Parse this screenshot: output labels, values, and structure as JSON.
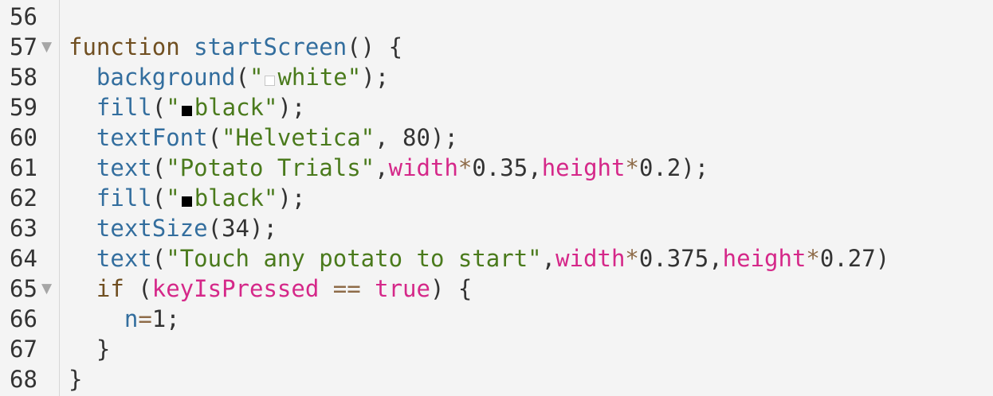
{
  "colors": {
    "background": "#f4f4f4",
    "gutter_border": "#d6d6d6",
    "keyword": "#704f21",
    "function": "#336e9e",
    "string": "#4a7a1c",
    "variable": "#d52889",
    "plain": "#333333",
    "fold_marker": "#a6a6a6"
  },
  "icons": {
    "fold_marker": "▼"
  },
  "line_numbers": [
    "56",
    "57",
    "58",
    "59",
    "60",
    "61",
    "62",
    "63",
    "64",
    "65",
    "66",
    "67",
    "68"
  ],
  "fold_lines": [
    "57",
    "65"
  ],
  "lines": [
    {
      "tokens": []
    },
    {
      "tokens": [
        {
          "t": "kw",
          "v": "function "
        },
        {
          "t": "fn",
          "v": "startScreen"
        },
        {
          "t": "pl",
          "v": "() {"
        }
      ]
    },
    {
      "tokens": [
        {
          "t": "pl",
          "v": "  "
        },
        {
          "t": "fn",
          "v": "background"
        },
        {
          "t": "pl",
          "v": "("
        },
        {
          "t": "str",
          "v": "\""
        },
        {
          "t": "swatch",
          "v": "white",
          "color": "#ffffff"
        },
        {
          "t": "str",
          "v": "white\""
        },
        {
          "t": "pl",
          "v": ");"
        }
      ]
    },
    {
      "tokens": [
        {
          "t": "pl",
          "v": "  "
        },
        {
          "t": "fn",
          "v": "fill"
        },
        {
          "t": "pl",
          "v": "("
        },
        {
          "t": "str",
          "v": "\""
        },
        {
          "t": "swatch",
          "v": "black",
          "color": "#000000"
        },
        {
          "t": "str",
          "v": "black\""
        },
        {
          "t": "pl",
          "v": ");"
        }
      ]
    },
    {
      "tokens": [
        {
          "t": "pl",
          "v": "  "
        },
        {
          "t": "fn",
          "v": "textFont"
        },
        {
          "t": "pl",
          "v": "("
        },
        {
          "t": "str",
          "v": "\"Helvetica\""
        },
        {
          "t": "pl",
          "v": ", 80);"
        }
      ]
    },
    {
      "tokens": [
        {
          "t": "pl",
          "v": "  "
        },
        {
          "t": "fn",
          "v": "text"
        },
        {
          "t": "pl",
          "v": "("
        },
        {
          "t": "str",
          "v": "\"Potato Trials\""
        },
        {
          "t": "pl",
          "v": ","
        },
        {
          "t": "var",
          "v": "width"
        },
        {
          "t": "op",
          "v": "*"
        },
        {
          "t": "pl",
          "v": "0.35,"
        },
        {
          "t": "var",
          "v": "height"
        },
        {
          "t": "op",
          "v": "*"
        },
        {
          "t": "pl",
          "v": "0.2);"
        }
      ]
    },
    {
      "tokens": [
        {
          "t": "pl",
          "v": "  "
        },
        {
          "t": "fn",
          "v": "fill"
        },
        {
          "t": "pl",
          "v": "("
        },
        {
          "t": "str",
          "v": "\""
        },
        {
          "t": "swatch",
          "v": "black",
          "color": "#000000"
        },
        {
          "t": "str",
          "v": "black\""
        },
        {
          "t": "pl",
          "v": ");"
        }
      ]
    },
    {
      "tokens": [
        {
          "t": "pl",
          "v": "  "
        },
        {
          "t": "fn",
          "v": "textSize"
        },
        {
          "t": "pl",
          "v": "(34);"
        }
      ]
    },
    {
      "tokens": [
        {
          "t": "pl",
          "v": "  "
        },
        {
          "t": "fn",
          "v": "text"
        },
        {
          "t": "pl",
          "v": "("
        },
        {
          "t": "str",
          "v": "\"Touch any potato to start\""
        },
        {
          "t": "pl",
          "v": ","
        },
        {
          "t": "var",
          "v": "width"
        },
        {
          "t": "op",
          "v": "*"
        },
        {
          "t": "pl",
          "v": "0.375,"
        },
        {
          "t": "var",
          "v": "height"
        },
        {
          "t": "op",
          "v": "*"
        },
        {
          "t": "pl",
          "v": "0.27)"
        }
      ]
    },
    {
      "tokens": [
        {
          "t": "pl",
          "v": "  "
        },
        {
          "t": "kw",
          "v": "if"
        },
        {
          "t": "pl",
          "v": " ("
        },
        {
          "t": "var",
          "v": "keyIsPressed"
        },
        {
          "t": "pl",
          "v": " "
        },
        {
          "t": "op",
          "v": "=="
        },
        {
          "t": "pl",
          "v": " "
        },
        {
          "t": "var",
          "v": "true"
        },
        {
          "t": "pl",
          "v": ") {"
        }
      ]
    },
    {
      "tokens": [
        {
          "t": "pl",
          "v": "    "
        },
        {
          "t": "fn",
          "v": "n"
        },
        {
          "t": "op",
          "v": "="
        },
        {
          "t": "pl",
          "v": "1;"
        }
      ]
    },
    {
      "tokens": [
        {
          "t": "pl",
          "v": "  }"
        }
      ]
    },
    {
      "tokens": [
        {
          "t": "pl",
          "v": "}"
        }
      ]
    }
  ]
}
